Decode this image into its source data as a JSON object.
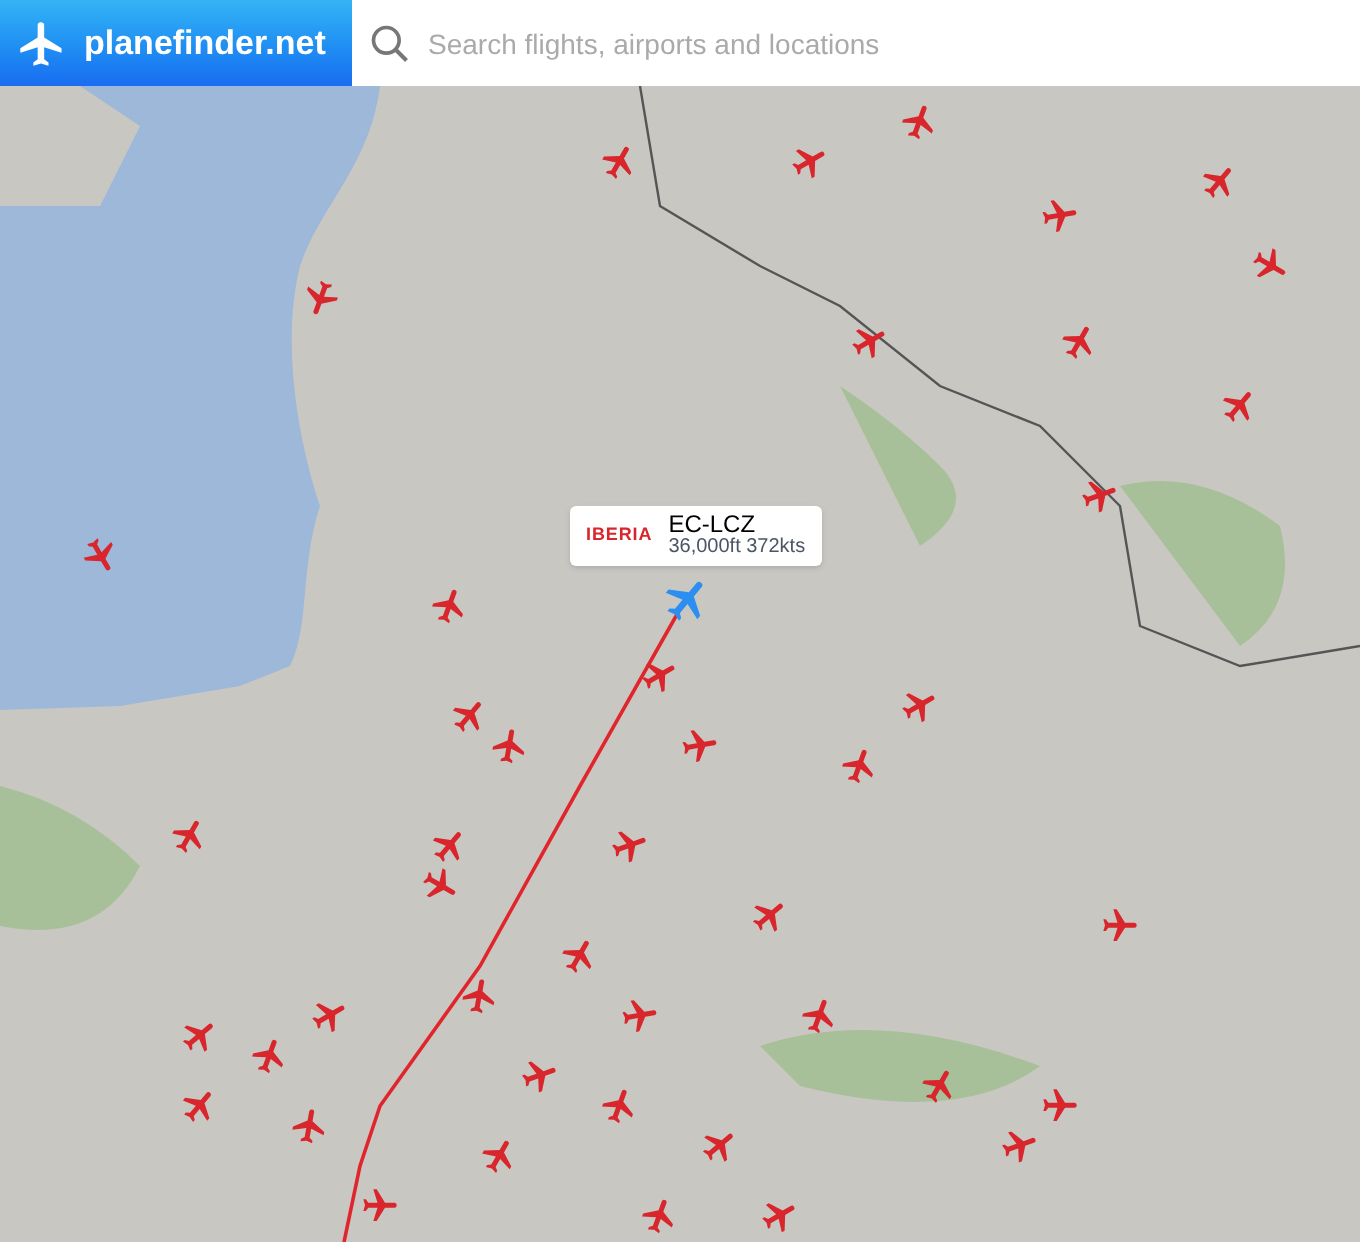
{
  "header": {
    "logo": "planefinder.net",
    "search": {
      "placeholder": "Search flights, airports and locations"
    }
  },
  "selected_flight": {
    "airline": "IBERIA",
    "callsign": "EC-LCZ",
    "details": "36,000ft 372kts"
  }
}
